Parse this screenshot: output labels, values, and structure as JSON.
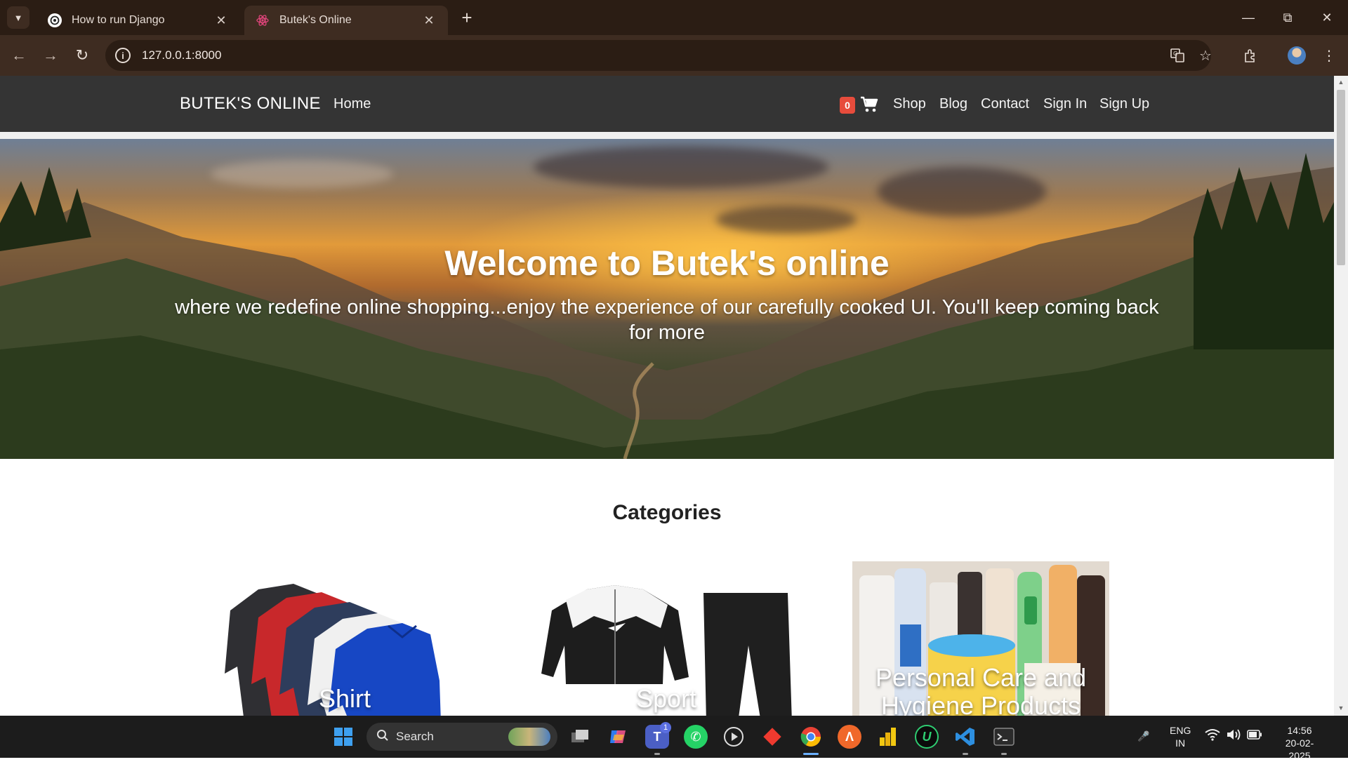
{
  "browser": {
    "tabs": [
      {
        "title": "How to run Django",
        "active": false
      },
      {
        "title": "Butek's Online",
        "active": true
      }
    ],
    "url": "127.0.0.1:8000"
  },
  "site": {
    "brand": "BUTEK'S ONLINE",
    "nav_left": [
      "Home"
    ],
    "cart_count": "0",
    "nav_right": [
      "Shop",
      "Blog",
      "Contact",
      "Sign In",
      "Sign Up"
    ],
    "hero_title": "Welcome to Butek's online",
    "hero_subtitle": "where we redefine online shopping...enjoy the experience of our carefully cooked UI. You'll keep coming back for more",
    "categories_title": "Categories",
    "categories": [
      {
        "label": "Shirt"
      },
      {
        "label": "Sport"
      },
      {
        "label": "Personal Care and Hygiene Products"
      }
    ]
  },
  "taskbar": {
    "search_placeholder": "Search",
    "teams_badge": "1",
    "language": "ENG",
    "region": "IN",
    "time": "14:56",
    "date": "20-02-2025"
  },
  "colors": {
    "tab_bar": "#2b1d14",
    "toolbar": "#3e2c21",
    "site_nav": "#343434",
    "cart_badge": "#e74c3c",
    "taskbar": "#1c1c1c"
  }
}
